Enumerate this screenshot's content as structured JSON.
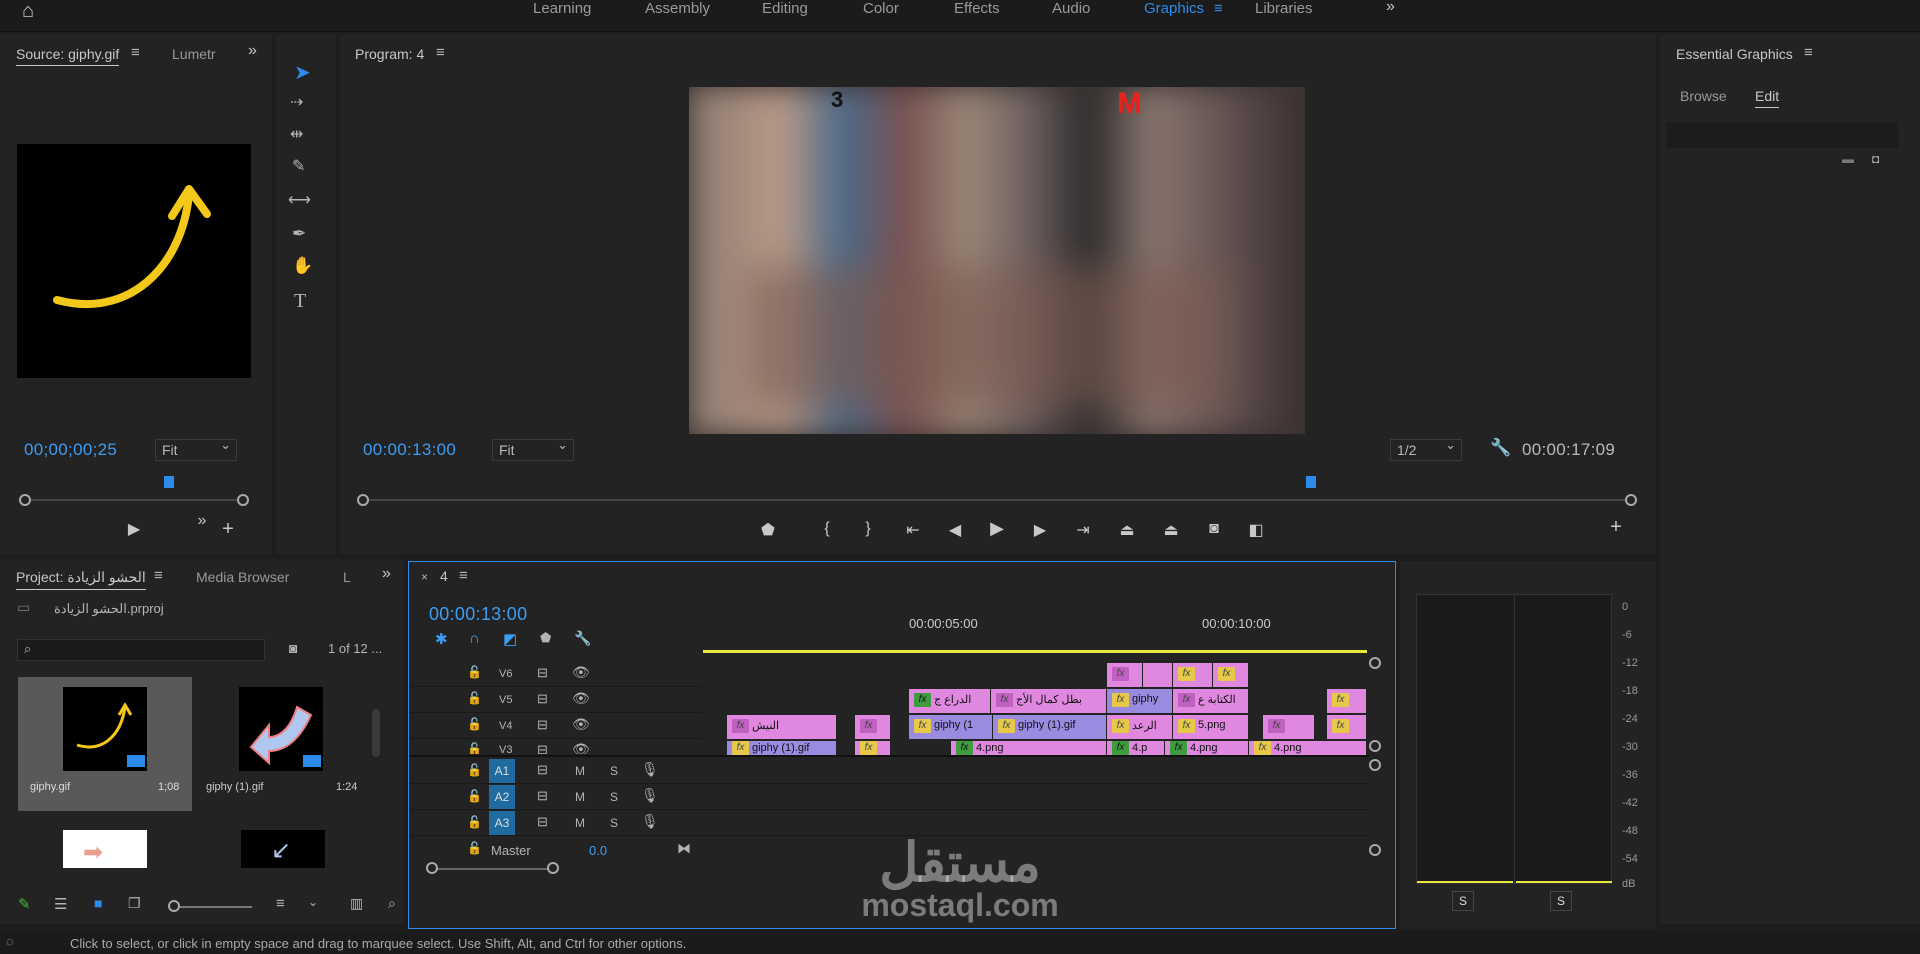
{
  "workspaces": {
    "items": [
      "Learning",
      "Assembly",
      "Editing",
      "Color",
      "Effects",
      "Audio",
      "Graphics",
      "Libraries"
    ],
    "active": "Graphics"
  },
  "source": {
    "tab_label": "Source: giphy.gif",
    "tab2_label": "Lumetr",
    "timecode": "00;00;00;25",
    "fit_label": "Fit"
  },
  "program": {
    "title": "Program: 4",
    "timecode": "00:00:13:00",
    "fit_label": "Fit",
    "resolution": "1/2",
    "duration": "00:00:17:09",
    "overlay_number": "3",
    "overlay_logo": "M"
  },
  "essential": {
    "title": "Essential Graphics",
    "tab_browse": "Browse",
    "tab_edit": "Edit"
  },
  "project": {
    "tab_label": "Project: الحشو الزيادة",
    "tab2_label": "Media Browser",
    "tab3_label": "L",
    "file_name": "الحشو الزيادة.prproj",
    "item_count": "1 of 12 ...",
    "items": [
      {
        "name": "giphy.gif",
        "duration": "1;08"
      },
      {
        "name": "giphy (1).gif",
        "duration": "1:24"
      }
    ]
  },
  "timeline": {
    "tab_label": "4",
    "timecode": "00:00:13:00",
    "ruler": [
      "00:00:05:00",
      "00:00:10:00"
    ],
    "tracks_video": [
      "V6",
      "V5",
      "V4",
      "V3"
    ],
    "tracks_audio": [
      "A1",
      "A2",
      "A3"
    ],
    "master_label": "Master",
    "master_value": "0.0",
    "track_m": "M",
    "track_s": "S",
    "clips": {
      "v5_a": "الدراع ج",
      "v5_b": "بطل كمال الأج",
      "v5_c": "giphy",
      "v5_d": "الكتابة ع",
      "v4_a": "النيش",
      "v4_b": "giphy (1",
      "v4_c": "giphy (1).gif",
      "v4_d": "الرعد",
      "v4_e": "5.png",
      "v3_a": "giphy (1).gif",
      "v3_b": "4.png",
      "v3_c": "4.p",
      "v3_d": "4.png",
      "v3_e": "4.png",
      "fx": "fx"
    }
  },
  "meter": {
    "scale": [
      "0",
      "-6",
      "-12",
      "-18",
      "-24",
      "-30",
      "-36",
      "-42",
      "-48",
      "-54",
      "dB"
    ],
    "solo_label": "S"
  },
  "status": {
    "text": "Click to select, or click in empty space and drag to marquee select. Use Shift, Alt, and Ctrl for other options."
  },
  "watermark": {
    "arabic": "مستقل",
    "latin": "mostaql.com"
  },
  "colors": {
    "accent": "#2d8ceb",
    "clip_pink": "#e088e0",
    "clip_violet": "#9a8ae0",
    "playhead": "#2d8ceb",
    "work_area": "#e8e83a"
  }
}
